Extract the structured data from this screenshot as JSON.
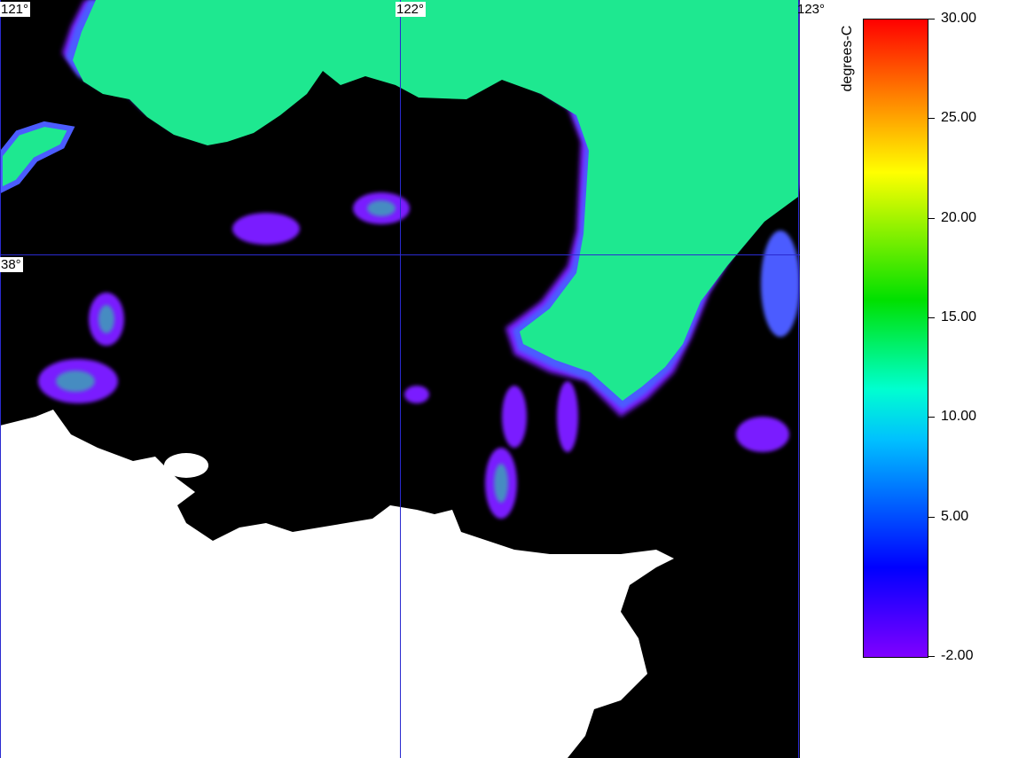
{
  "map": {
    "lon_labels": [
      "121°",
      "122°",
      "123°"
    ],
    "lat_labels": [
      "38°"
    ],
    "colors": {
      "water_default": "#000000",
      "land": "#ffffff",
      "warm_water": "#1ee890",
      "cool_fringe": "#4b5cff",
      "cold_edge": "#7a1cff",
      "gridline": "#2a2ad0"
    }
  },
  "colorbar": {
    "title": "degrees-C",
    "ticks": [
      "30.00",
      "25.00",
      "20.00",
      "15.00",
      "10.00",
      "5.00",
      "-2.00"
    ],
    "values": [
      30,
      25,
      20,
      15,
      10,
      5,
      -2
    ],
    "min": -2,
    "max": 30
  }
}
